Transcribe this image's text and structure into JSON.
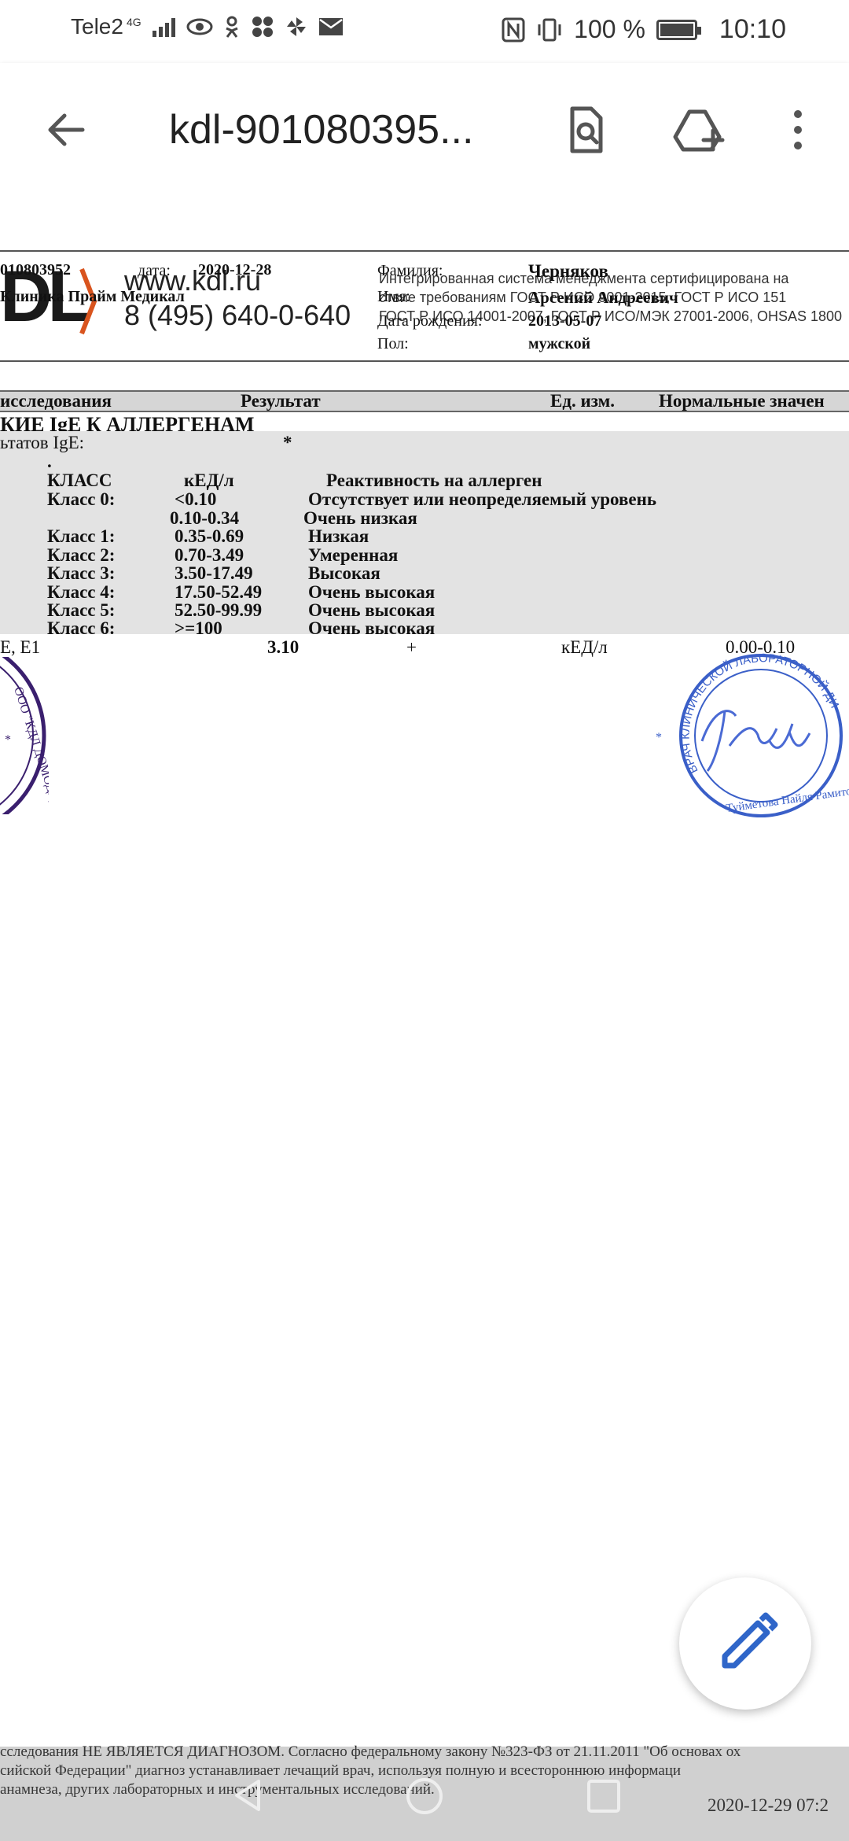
{
  "status_bar": {
    "carrier": "Tele2",
    "network": "4G",
    "battery": "100 %",
    "time": "10:10"
  },
  "app_bar": {
    "title": "kdl-901080395...",
    "back_icon": "arrow-left-icon",
    "search_icon": "document-search-icon",
    "drive_icon": "add-to-drive-icon",
    "menu_icon": "more-vert-icon"
  },
  "doc": {
    "logo_text": "DL",
    "website": "www.kdl.ru",
    "phone": "8 (495) 640-0-640",
    "cert_lines": [
      "Интегрированная система менеджмента сертифицирована на",
      "ствие требованиям ГОСТ Р ИСО 9001-2015, ГОСТ Р ИСО 151",
      "ГОСТ Р ИСО 14001-2007, ГОСТ Р ИСО/МЭК 27001-2006, OHSAS 1800"
    ],
    "order_no": "010803952",
    "date_label": "дата:",
    "date_value": "2020-12-28",
    "clinic": "Клиника Прайм Медикал",
    "lastname_label": "Фамилия:",
    "lastname_value": "Черняков",
    "name_label": "Имя:",
    "name_value": "Арсений Андреевич",
    "birth_label": "Дата рождения:",
    "birth_value": "2013-05-07",
    "sex_label": "Пол:",
    "sex_value": "мужской",
    "table_header": {
      "col1": "исследования",
      "col2": "Результат",
      "col3": "Ед. изм.",
      "col4": "Нормальные значен"
    },
    "section_title": "КИЕ IgE К АЛЛЕРГЕНАМ",
    "interp_label": "ьтатов IgE:",
    "interp_mark": "*",
    "dot": ".",
    "class_header": {
      "c1": "КЛАСС",
      "c2": "кЕД/л",
      "c3": "Реактивность на аллерген"
    },
    "classes": [
      {
        "name": "Класс 0:",
        "range": "<0.10",
        "desc": "Отсутствует или неопределяемый уровень"
      },
      {
        "name": "",
        "range": "0.10-0.34",
        "desc": "Очень низкая"
      },
      {
        "name": "Класс 1:",
        "range": "0.35-0.69",
        "desc": "Низкая"
      },
      {
        "name": "Класс 2:",
        "range": "0.70-3.49",
        "desc": "Умеренная"
      },
      {
        "name": "Класс 3:",
        "range": "3.50-17.49",
        "desc": "Высокая"
      },
      {
        "name": "Класс 4:",
        "range": "17.50-52.49",
        "desc": "Очень высокая"
      },
      {
        "name": "Класс 5:",
        "range": "52.50-99.99",
        "desc": "Очень высокая"
      },
      {
        "name": "Класс 6:",
        "range": ">=100",
        "desc": "Очень высокая"
      }
    ],
    "result": {
      "name": "E, E1",
      "value": "3.10",
      "flag": "+",
      "unit": "кЕД/л",
      "norm": "0.00-0.10"
    },
    "stamp_left_text": "ООО \"КДЛ ДОМОДЕДОВО",
    "stamp_right_text": "ВРАЧ КЛИНИЧЕСКОЙ ЛАБОРАТОРНОЙ ДИ · Туйметова Найля Рамитов",
    "footer_lines": [
      "сследования НЕ ЯВЛЯЕТСЯ ДИАГНОЗОМ. Согласно федеральному закону №323-ФЗ от 21.11.2011 \"Об основах ох",
      "сийской Федерации\" диагноз устанавливает лечащий врач, используя полную и всестороннюю информаци",
      "анамнеза, других лабораторных и инструментальных исследований."
    ],
    "print_datetime": "2020-12-29 07:2"
  },
  "fab_icon": "pencil-icon",
  "colors": {
    "stamp_left": "#3a1f6e",
    "stamp_right": "#3a5fc8",
    "logo_accent": "#d9541e",
    "fab_icon": "#2f66c9"
  }
}
